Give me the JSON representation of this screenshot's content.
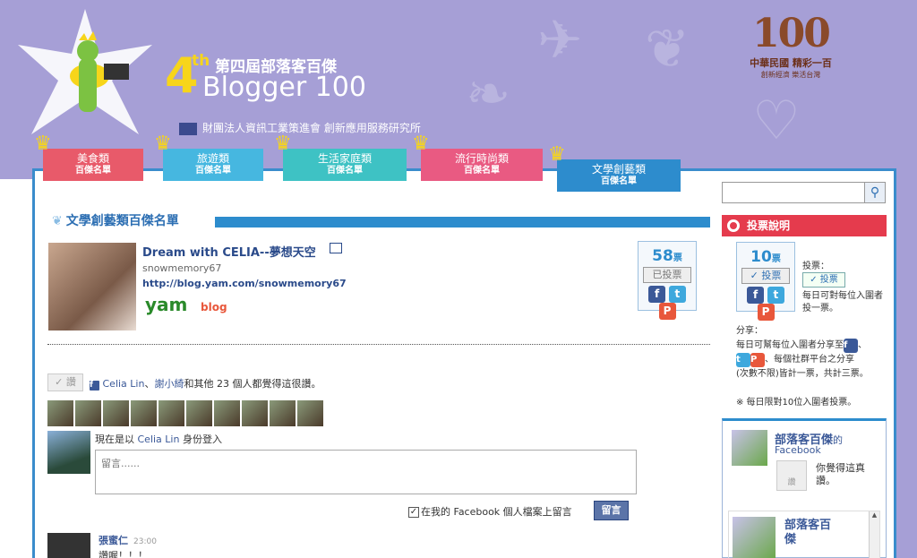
{
  "header": {
    "brand_num": "4",
    "brand_sup": "th",
    "brand_zh": "第四屆部落客百傑",
    "brand_en": "Blogger 100",
    "org": "財團法人資訊工業策進會 創新應用服務研究所",
    "logo_big": "100",
    "logo_line1": "中華民國 精彩一百",
    "logo_line2": "創新經濟 樂活台灣"
  },
  "tabs": [
    {
      "l1": "美食類",
      "l2": "百傑名單"
    },
    {
      "l1": "旅遊類",
      "l2": "百傑名單"
    },
    {
      "l1": "生活家庭類",
      "l2": "百傑名單"
    },
    {
      "l1": "流行時尚類",
      "l2": "百傑名單"
    },
    {
      "l1": "文學創藝類",
      "l2": "百傑名單"
    }
  ],
  "category": {
    "title": "文學創藝類百傑名單"
  },
  "blog": {
    "title": "Dream with CELIA--夢想天空",
    "user": "snowmemory67",
    "url": "http://blog.yam.com/snowmemory67",
    "yam": "yam",
    "yam_blog": "blog"
  },
  "vote": {
    "count": "58",
    "unit": "票",
    "voted_label": "已投票",
    "share_fb": "f",
    "share_tw": "t",
    "share_pl": "P"
  },
  "like": {
    "button": "讚",
    "name1": "Celia Lin",
    "sep": "、",
    "name2": "謝小綺",
    "rest": "和其他 23 個人都覺得這很讚。"
  },
  "login": {
    "prefix": "現在是以",
    "name": "Celia Lin",
    "suffix": "身份登入"
  },
  "comment": {
    "placeholder": "留言......",
    "post_to_fb": "在我的 Facebook 個人檔案上留言",
    "post_button": "留言",
    "first_name": "張蜜仁",
    "first_time": "23:00",
    "first_body": "讚喔！！！"
  },
  "sidebar": {
    "vote_title": "投票說明",
    "demo_count": "10",
    "demo_unit": "票",
    "demo_vote_label": "投票",
    "vote_label": "投票：",
    "vote_btn": "投票",
    "vote_rule": "每日可對每位入圍者投一票。",
    "share_title": "分享：",
    "share_rule1": "每日可幫每位入圍者分享至",
    "share_rule2": "、每個社群平台之分享",
    "share_rule3": "(次數不限)皆計一票，共計三票。",
    "daily_note": "※ 每日限對10位入圍者投票。",
    "fb_title": "部落客百傑",
    "fb_title_suffix": "的",
    "fb_sub": "Facebook",
    "fb_like_btn": "讚",
    "fb_like_text": "你覺得這真讚。",
    "fb_inner_title": "部落客百傑"
  }
}
